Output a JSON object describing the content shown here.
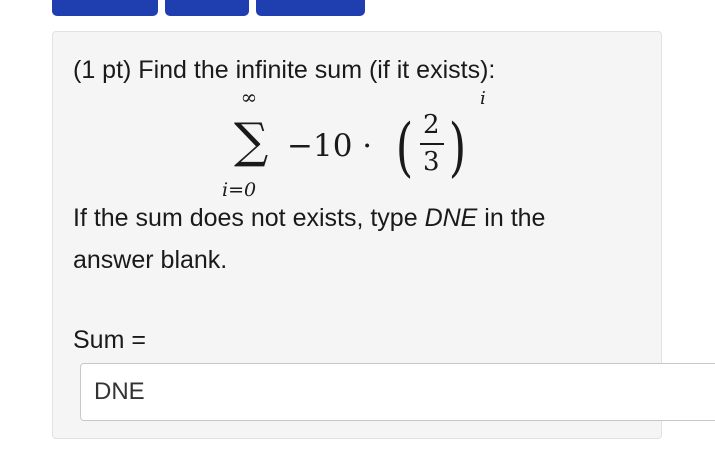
{
  "problem": {
    "prompt": "(1 pt) Find the infinite sum (if it exists):",
    "math": {
      "upper_limit": "∞",
      "sigma": "∑",
      "lower_limit": "i=0",
      "coefficient": "−10 ·",
      "paren_left": "(",
      "numerator": "2",
      "denominator": "3",
      "paren_right": ")",
      "exponent": "i"
    },
    "instruction_line1": "If the sum does not exists, type DNE in the",
    "instruction_line2": "answer blank.",
    "sum_label": "Sum =",
    "answer_value": "DNE"
  },
  "colors": {
    "top_tab": "#1f3fb0",
    "panel_bg": "#f5f5f5"
  }
}
